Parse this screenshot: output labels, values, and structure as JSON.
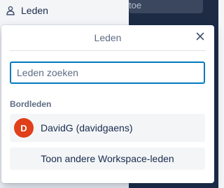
{
  "sidebar": {
    "members_item": {
      "icon": "person-icon",
      "label": "Leden"
    }
  },
  "board": {
    "partial_card_text": "toe"
  },
  "popover": {
    "title": "Leden",
    "close_icon": "close-icon",
    "search": {
      "placeholder": "Leden zoeken",
      "value": ""
    },
    "section_label": "Bordleden",
    "members": [
      {
        "avatar_initial": "D",
        "avatar_color": "#e03f1a",
        "name": "DavidG (davidgaens)"
      }
    ],
    "show_button_label": "Toon andere Workspace-leden"
  },
  "colors": {
    "accent": "#0079bf",
    "board_bg": "#1d2b45",
    "avatar": "#e03f1a"
  }
}
